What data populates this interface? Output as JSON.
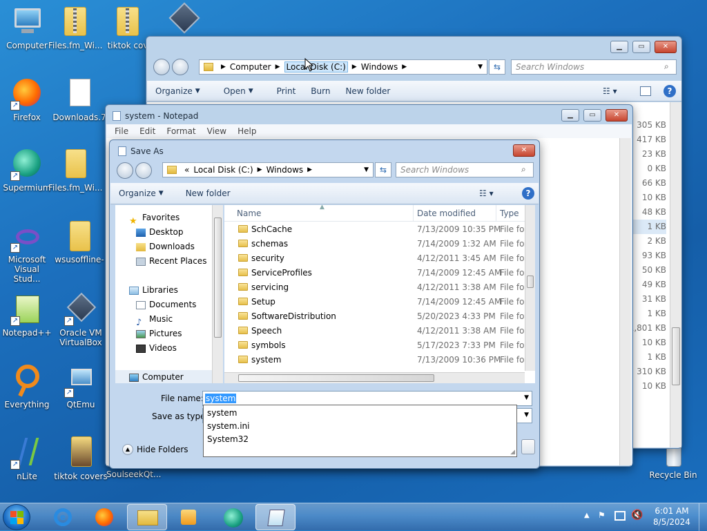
{
  "desktop": {
    "icons": [
      {
        "label": "Computer"
      },
      {
        "label": "Files.fm_Wi..."
      },
      {
        "label": "tiktok cov"
      },
      {
        "label": "Firefox"
      },
      {
        "label": "Downloads.7"
      },
      {
        "label": "Supermium"
      },
      {
        "label": "Files.fm_Wi..."
      },
      {
        "label": "Microsoft Visual Stud..."
      },
      {
        "label": "wsusoffline-"
      },
      {
        "label": "Notepad++"
      },
      {
        "label": "Oracle VM VirtualBox"
      },
      {
        "label": "Everything"
      },
      {
        "label": "QtEmu"
      },
      {
        "label": "nLite"
      },
      {
        "label": "tiktok covers"
      },
      {
        "label": "SoulseekQt..."
      },
      {
        "label": "Recycle Bin"
      }
    ]
  },
  "explorer": {
    "breadcrumb": [
      "Computer",
      "Local Disk (C:)",
      "Windows"
    ],
    "search_placeholder": "Search Windows",
    "toolbar": {
      "organize": "Organize",
      "open": "Open",
      "print": "Print",
      "burn": "Burn",
      "new_folder": "New folder"
    },
    "sizes": [
      "305 KB",
      "417 KB",
      "23 KB",
      "0 KB",
      "66 KB",
      "10 KB",
      "48 KB",
      "1 KB",
      "2 KB",
      "93 KB",
      "50 KB",
      "49 KB",
      "31 KB",
      "1 KB",
      "1,801 KB",
      "10 KB",
      "1 KB",
      "310 KB",
      "10 KB"
    ]
  },
  "notepad": {
    "title": "system - Notepad",
    "menu": [
      "File",
      "Edit",
      "Format",
      "View",
      "Help"
    ]
  },
  "save_as": {
    "title": "Save As",
    "breadcrumb_prefix": "«",
    "breadcrumb": [
      "Local Disk (C:)",
      "Windows"
    ],
    "search_placeholder": "Search Windows",
    "organize": "Organize",
    "new_folder": "New folder",
    "nav": {
      "favorites": "Favorites",
      "favorites_items": [
        "Desktop",
        "Downloads",
        "Recent Places"
      ],
      "libraries": "Libraries",
      "libraries_items": [
        "Documents",
        "Music",
        "Pictures",
        "Videos"
      ],
      "computer": "Computer"
    },
    "columns": {
      "name": "Name",
      "date": "Date modified",
      "type": "Type"
    },
    "rows": [
      {
        "name": "SchCache",
        "date": "7/13/2009 10:35 PM",
        "type": "File fol"
      },
      {
        "name": "schemas",
        "date": "7/14/2009 1:32 AM",
        "type": "File fol"
      },
      {
        "name": "security",
        "date": "4/12/2011 3:45 AM",
        "type": "File fol"
      },
      {
        "name": "ServiceProfiles",
        "date": "7/14/2009 12:45 AM",
        "type": "File fol"
      },
      {
        "name": "servicing",
        "date": "4/12/2011 3:38 AM",
        "type": "File fol"
      },
      {
        "name": "Setup",
        "date": "7/14/2009 12:45 AM",
        "type": "File fol"
      },
      {
        "name": "SoftwareDistribution",
        "date": "5/20/2023 4:33 PM",
        "type": "File fol"
      },
      {
        "name": "Speech",
        "date": "4/12/2011 3:38 AM",
        "type": "File fol"
      },
      {
        "name": "symbols",
        "date": "5/17/2023 7:33 PM",
        "type": "File fol"
      },
      {
        "name": "system",
        "date": "7/13/2009 10:36 PM",
        "type": "File fol"
      }
    ],
    "file_name_label": "File name:",
    "file_name_value": "system",
    "save_as_type_label": "Save as type:",
    "autocomplete": [
      "system",
      "system.ini",
      "System32"
    ],
    "hide_folders": "Hide Folders"
  },
  "taskbar": {
    "time": "6:01 AM",
    "date": "8/5/2024"
  }
}
